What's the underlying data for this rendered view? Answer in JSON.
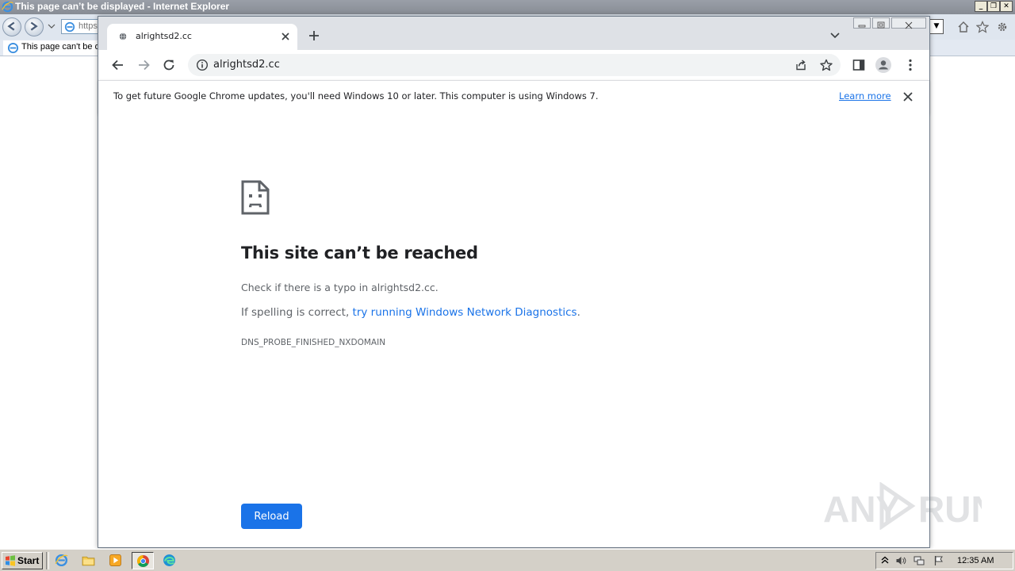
{
  "ie": {
    "window_title": "This page can’t be displayed - Internet Explorer",
    "address_text": "https",
    "tab_label": "This page can't be d"
  },
  "chrome": {
    "tab_title": "alrightsd2.cc",
    "url": "alrightsd2.cc",
    "infobar": {
      "message": "To get future Google Chrome updates, you'll need Windows 10 or later. This computer is using Windows 7.",
      "link_label": "Learn more"
    }
  },
  "error_page": {
    "title": "This site can’t be reached",
    "line1": "Check if there is a typo in alrightsd2.cc.",
    "line2_prefix": "If spelling is correct, ",
    "line2_link": "try running Windows Network Diagnostics",
    "line2_suffix": ".",
    "error_code": "DNS_PROBE_FINISHED_NXDOMAIN",
    "reload_label": "Reload"
  },
  "watermark": {
    "text_left": "ANY",
    "text_right": "RUN"
  },
  "taskbar": {
    "start_label": "Start",
    "clock": "12:35 AM"
  },
  "colors": {
    "chrome_accent": "#1a73e8",
    "chrome_tabstrip": "#dee1e6",
    "taskbar_bg": "#d4d0c8",
    "text_primary": "#202124",
    "text_secondary": "#5f6368"
  },
  "icons": {
    "ie_title_icon": "ie-logo-icon",
    "tab_favicon": "globe-icon",
    "error_icon": "sad-document-icon",
    "taskbar_apps": [
      "ie-icon",
      "explorer-folder-icon",
      "media-player-icon",
      "chrome-icon",
      "edge-icon"
    ],
    "tray": [
      "show-hidden-icons-icon",
      "volume-icon",
      "network-icon",
      "action-center-flag-icon"
    ]
  }
}
